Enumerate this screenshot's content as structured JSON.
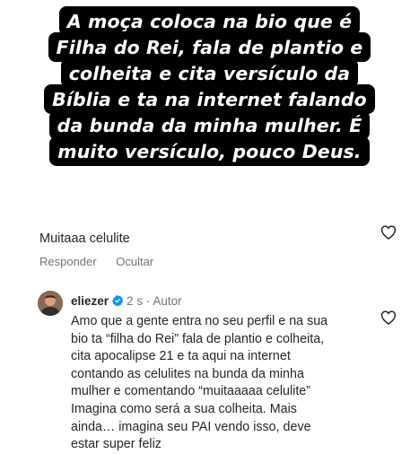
{
  "caption": {
    "lines": [
      "A moça coloca na bio que é",
      "Filha do Rei, fala de plantio e",
      "colheita e cita versículo da",
      "Bíblia e ta na internet falando",
      "da bunda da minha mulher. É",
      "muito versículo, pouco Deus."
    ]
  },
  "comment": {
    "text": "Muitaaa celulite",
    "actions": {
      "reply": "Responder",
      "hide": "Ocultar"
    }
  },
  "reply": {
    "username": "eliezer",
    "time": "2 s",
    "separator": "·",
    "role": "Autor",
    "lines": [
      "Amo que a gente entra no seu perfil e na sua",
      "bio ta “filha do Rei” fala de plantio e colheita,",
      "cita apocalipse 21 e ta aqui na internet",
      "contando as celulites na bunda da minha",
      "mulher e comentando “muitaaaaa celulite”",
      "Imagina como será a sua colheita. Mais",
      "ainda… imagina seu PAI vendo isso, deve",
      "estar super feliz"
    ]
  },
  "colors": {
    "verified": "#0095f6",
    "muted": "#737373",
    "text": "#262626",
    "caption_bg": "#000000"
  },
  "icons": [
    "heart-outline-icon",
    "verified-badge-icon"
  ]
}
